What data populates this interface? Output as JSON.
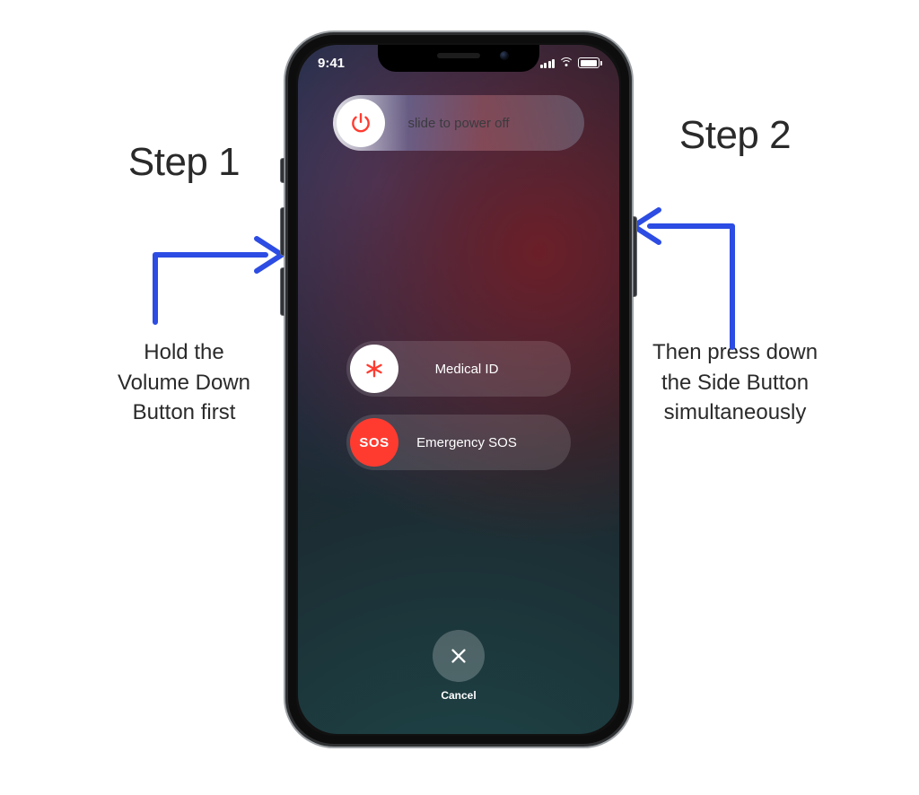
{
  "status": {
    "time": "9:41"
  },
  "sliders": {
    "power_label": "slide to power off",
    "medical_label": "Medical ID",
    "sos_label": "Emergency SOS",
    "sos_handle": "SOS"
  },
  "cancel": {
    "label": "Cancel"
  },
  "annotations": {
    "step1": {
      "title": "Step 1",
      "body": "Hold the\nVolume Down\nButton first"
    },
    "step2": {
      "title": "Step 2",
      "body": "Then press down\nthe Side Button\nsimultaneously"
    }
  },
  "colors": {
    "arrow": "#2C4CE3",
    "red": "#ff3b30"
  }
}
